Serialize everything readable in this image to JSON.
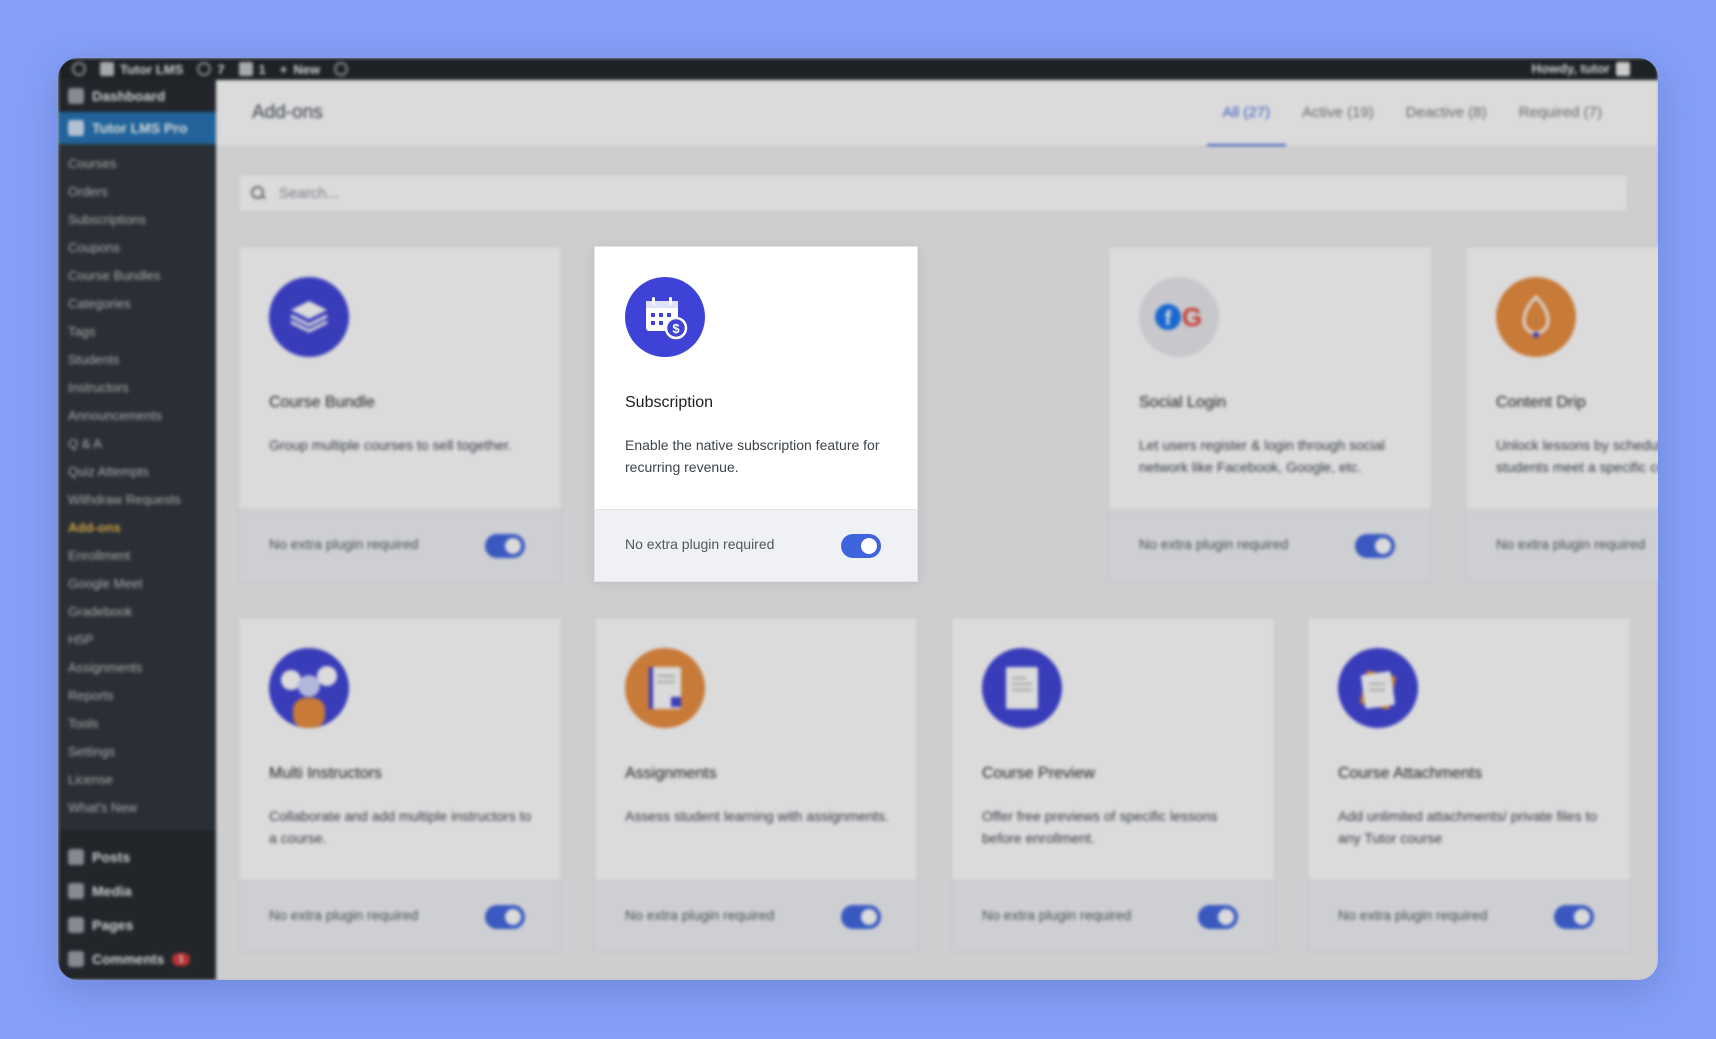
{
  "adminbar": {
    "site_name": "Tutor LMS",
    "updates": "7",
    "comments": "1",
    "new_label": "New",
    "howdy": "Howdy, tutor"
  },
  "sidebar": {
    "dashboard": "Dashboard",
    "plugin": "Tutor LMS Pro",
    "items": [
      "Courses",
      "Orders",
      "Subscriptions",
      "Coupons",
      "Course Bundles",
      "Categories",
      "Tags",
      "Students",
      "Instructors",
      "Announcements",
      "Q & A",
      "Quiz Attempts",
      "Withdraw Requests",
      "Add-ons",
      "Enrollment",
      "Google Meet",
      "Gradebook",
      "H5P",
      "Assignments",
      "Reports",
      "Tools",
      "Settings",
      "License",
      "What's New"
    ],
    "current": "Add-ons",
    "bottom": [
      "Posts",
      "Media",
      "Pages",
      "Comments"
    ],
    "comments_badge": "1"
  },
  "header": {
    "title": "Add-ons",
    "tabs": [
      "All (27)",
      "Active (19)",
      "Deactive (8)",
      "Required (7)"
    ]
  },
  "search": {
    "placeholder": "Search..."
  },
  "addons": [
    {
      "name": "Course Bundle",
      "desc": "Group multiple courses to sell together.",
      "footer": "No extra plugin required",
      "color": "#3e42d6",
      "icon": "layers-icon"
    },
    {
      "name": "Subscription",
      "desc": "Enable the native subscription feature for recurring revenue.",
      "footer": "No extra plugin required",
      "color": "#3e42d6",
      "icon": "calendar-dollar-icon"
    },
    {
      "name": "Social Login",
      "desc": "Let users register & login through social network like Facebook, Google, etc.",
      "footer": "No extra plugin required",
      "color": "#e8e8ec",
      "icon": "facebook-google-icon"
    },
    {
      "name": "Content Drip",
      "desc": "Unlock lessons by schedule or when students meet a specific condition.",
      "footer": "No extra plugin required",
      "color": "#e98c3c",
      "icon": "drip-icon"
    },
    {
      "name": "Multi Instructors",
      "desc": "Collaborate and add multiple instructors to a course.",
      "footer": "No extra plugin required",
      "color": "#3e42d6",
      "icon": "instructors-icon"
    },
    {
      "name": "Assignments",
      "desc": "Assess student learning with assignments.",
      "footer": "No extra plugin required",
      "color": "#e98c3c",
      "icon": "assignment-icon"
    },
    {
      "name": "Course Preview",
      "desc": "Offer free previews of specific lessons before enrollment.",
      "footer": "No extra plugin required",
      "color": "#3e42d6",
      "icon": "document-icon"
    },
    {
      "name": "Course Attachments",
      "desc": "Add unlimited attachments/ private files to any Tutor course",
      "footer": "No extra plugin required",
      "color": "#3e42d6",
      "icon": "attachment-icon"
    }
  ]
}
